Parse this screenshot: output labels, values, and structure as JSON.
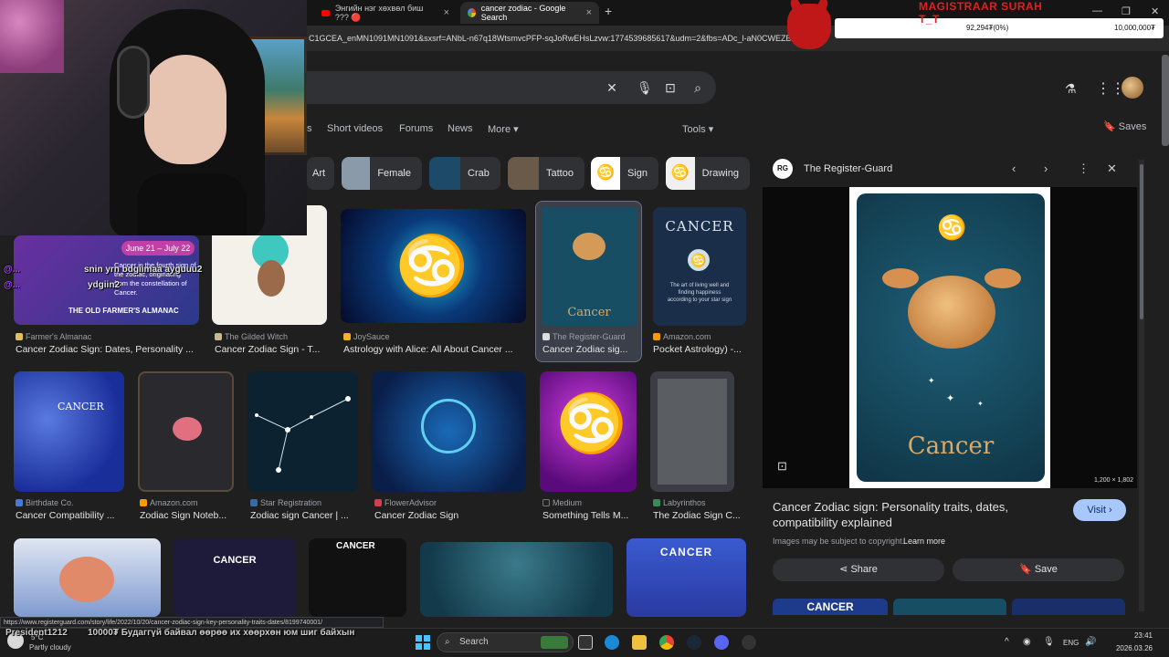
{
  "browser": {
    "tabs": [
      {
        "label": "Энгийн нэг хөхвөл биш ??? 🔴"
      },
      {
        "label": "cancer zodiac - Google Search"
      }
    ],
    "new_tab": "+",
    "address": "C1GCEA_enMN1091MN1091&sxsrf=ANbL-n67q18WtsmvcPFP-sqJoRwEHsLzvw:1774539685617&udm=2&fbs=ADc_l-aN0CWEZBO"
  },
  "overlay": {
    "title": "MAGISTRAAR SURAH T_T",
    "progress_left": "92,294₮(0%)",
    "progress_right": "10,000,000₮",
    "progress_fraction": 0.0
  },
  "search": {
    "filters": [
      "Short videos",
      "Forums",
      "News",
      "More ▾"
    ],
    "tools": "Tools ▾",
    "saves": "Saves",
    "chips": [
      {
        "label": "Art",
        "color": "#303134"
      },
      {
        "label": "Female",
        "color": "#6a7a8a"
      },
      {
        "label": "Crab",
        "color": "#1e4a6a"
      },
      {
        "label": "Tattoo",
        "color": "#5a4a3a"
      },
      {
        "label": "Sign",
        "color": "#ffffff"
      },
      {
        "label": "Drawing",
        "color": "#f0f0f0"
      }
    ],
    "results": [
      {
        "source": "Farmer's Almanac",
        "title": "Cancer Zodiac Sign: Dates, Personality ..."
      },
      {
        "source": "The Gilded Witch",
        "title": "Cancer Zodiac Sign - T..."
      },
      {
        "source": "JoySauce",
        "title": "Astrology with Alice: All About Cancer ..."
      },
      {
        "source": "The Register-Guard",
        "title": "Cancer Zodiac sig..."
      },
      {
        "source": "Amazon.com",
        "title": "Pocket Astrology) -..."
      },
      {
        "source": "Birthdate Co.",
        "title": "Cancer Compatibility ..."
      },
      {
        "source": "Amazon.com",
        "title": "Zodiac Sign Noteb..."
      },
      {
        "source": "Star Registration",
        "title": "Zodiac sign Cancer | ..."
      },
      {
        "source": "FlowerAdvisor",
        "title": "Cancer Zodiac Sign"
      },
      {
        "source": "Medium",
        "title": "Something Tells M..."
      },
      {
        "source": "Labyrinthos",
        "title": "The Zodiac Sign C..."
      }
    ],
    "image_texts": {
      "almanac_dates": "June 21 – July 22",
      "almanac_body": "Cancer is the fourth sign of the zodiac, originating from the constellation of Cancer.",
      "almanac_brand": "THE OLD FARMER'S ALMANAC",
      "register_guard": "Cancer",
      "amazon_title": "CANCER",
      "amazon_body": "The art of living well and finding happiness according to your star sign",
      "birthdate_title": "CANCER",
      "row3_cancer1": "CANCER",
      "row3_cancer2": "CANCER",
      "row3_cancer3": "CANCER"
    }
  },
  "panel": {
    "source": "The Register-Guard",
    "logo": "RG",
    "preview_label": "Cancer",
    "dimensions": "1,200 × 1,802",
    "title": "Cancer Zodiac sign: Personality traits, dates, compatibility explained",
    "visit": "Visit ›",
    "copyright": "Images may be subject to copyright.",
    "learn_more": "Learn more",
    "share": "Share",
    "save": "Save",
    "related_label": "CANCER"
  },
  "status_url": "https://www.registerguard.com/story/life/2022/10/20/cancer-zodiac-sign-key-personality-traits-dates/8199740001/",
  "chat": [
    {
      "user": "@...",
      "text": "snin yrn bdgiimaa ayguuu2",
      "color": "#ffffff"
    },
    {
      "user": "@...",
      "text": "ydgiin2",
      "color": "#ffffff"
    },
    {
      "user": "President1212",
      "text": "10000₮ Будаггүй байвал өөрөө их хөөрхөн юм шиг байхын",
      "color": "#ffffff"
    }
  ],
  "taskbar": {
    "weather_temp": "5°C",
    "weather": "Partly cloudy",
    "search": "Search",
    "lang": "ENG",
    "time": "23:41",
    "date": "2026.03.26"
  }
}
